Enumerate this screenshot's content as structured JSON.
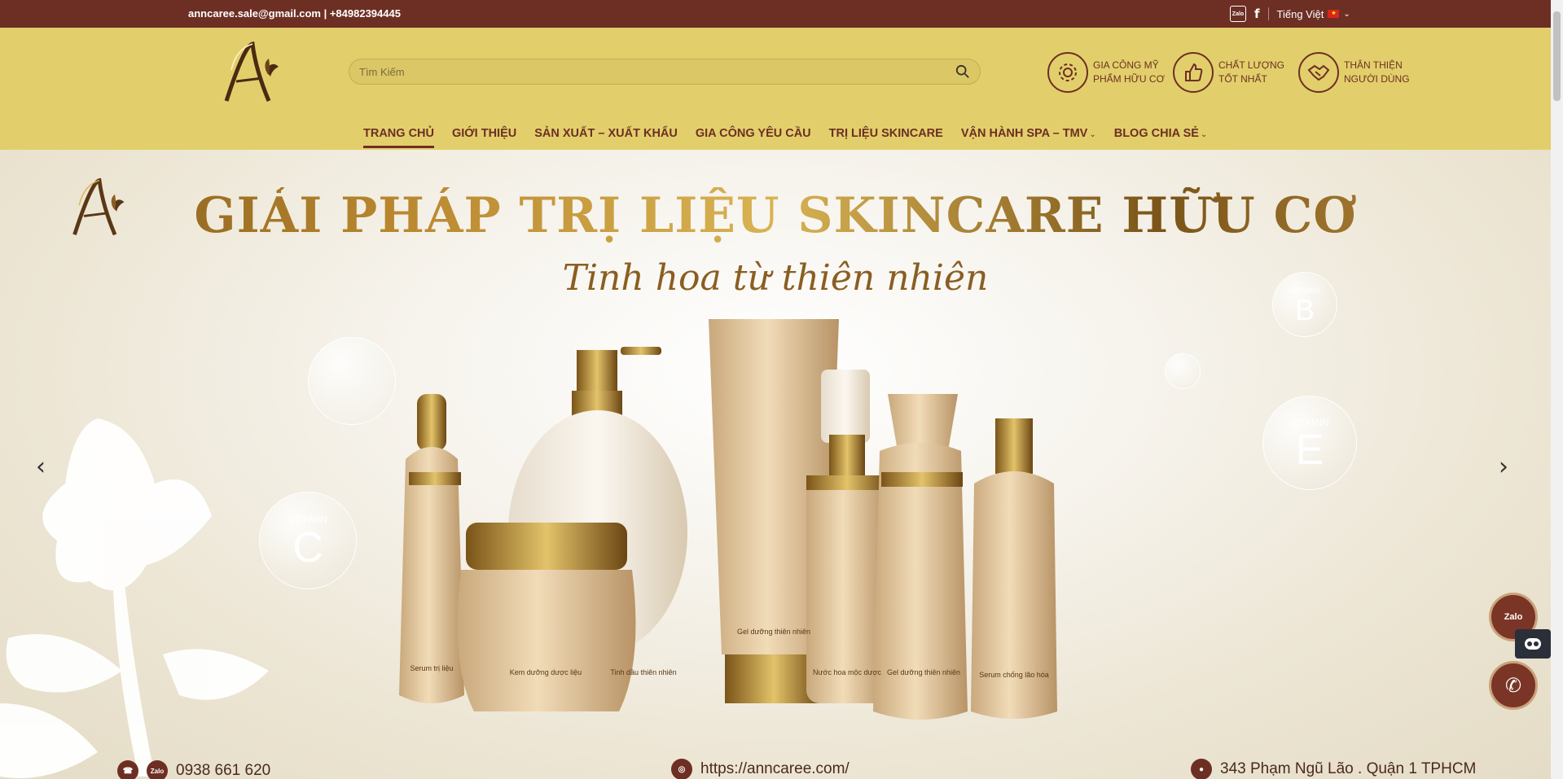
{
  "topbar": {
    "contact": "anncaree.sale@gmail.com | +84982394445",
    "zalo_icon": "Zalo",
    "facebook_icon": "f",
    "language": "Tiếng Việt"
  },
  "header": {
    "search_placeholder": "Tìm Kiếm",
    "features": [
      {
        "icon": "gear-icon",
        "line1": "GIA CÔNG MỸ",
        "line2": "PHẨM HỮU CƠ"
      },
      {
        "icon": "thumbs-up-icon",
        "line1": "CHẤT LƯỢNG",
        "line2": "TỐT NHẤT"
      },
      {
        "icon": "handshake-icon",
        "line1": "THÂN THIỆN",
        "line2": "NGƯỜI DÙNG"
      }
    ]
  },
  "nav": {
    "items": [
      {
        "label": "TRANG CHỦ",
        "active": true
      },
      {
        "label": "GIỚI THIỆU"
      },
      {
        "label": "SẢN XUẤT – XUẤT KHẨU"
      },
      {
        "label": "GIA CÔNG YÊU CẦU"
      },
      {
        "label": "TRỊ LIỆU SKINCARE"
      },
      {
        "label": "VẬN HÀNH SPA – TMV",
        "dropdown": true
      },
      {
        "label": "BLOG CHIA SẺ",
        "dropdown": true
      }
    ]
  },
  "hero": {
    "headline": "GIẢI PHÁP TRỊ LIỆU SKINCARE HỮU CƠ",
    "subline": "Tinh hoa từ thiên nhiên",
    "bubbles": [
      {
        "title": "VITAMIN",
        "letter": "B"
      },
      {
        "title": "VITAMIN",
        "letter": "E"
      },
      {
        "title": "VITAMIN",
        "letter": "C"
      }
    ],
    "products": [
      "Serum trị liệu",
      "Kem dưỡng dược liệu",
      "Tinh dầu thiên nhiên",
      "Gel dưỡng thiên nhiên",
      "Nước hoa mộc dược",
      "Gel dưỡng thiên nhiên",
      "Serum chống lão hóa"
    ],
    "phone": "0938 661 620",
    "zalo_label": "Zalo",
    "website": "https://anncaree.com/",
    "address": "343 Phạm Ngũ Lão . Quận 1 TPHCM"
  },
  "floating": {
    "zalo": "Zalo"
  },
  "colors": {
    "brown": "#6d2f24",
    "gold_header": "#e2cf6b",
    "gold_text": "#b8862e"
  }
}
